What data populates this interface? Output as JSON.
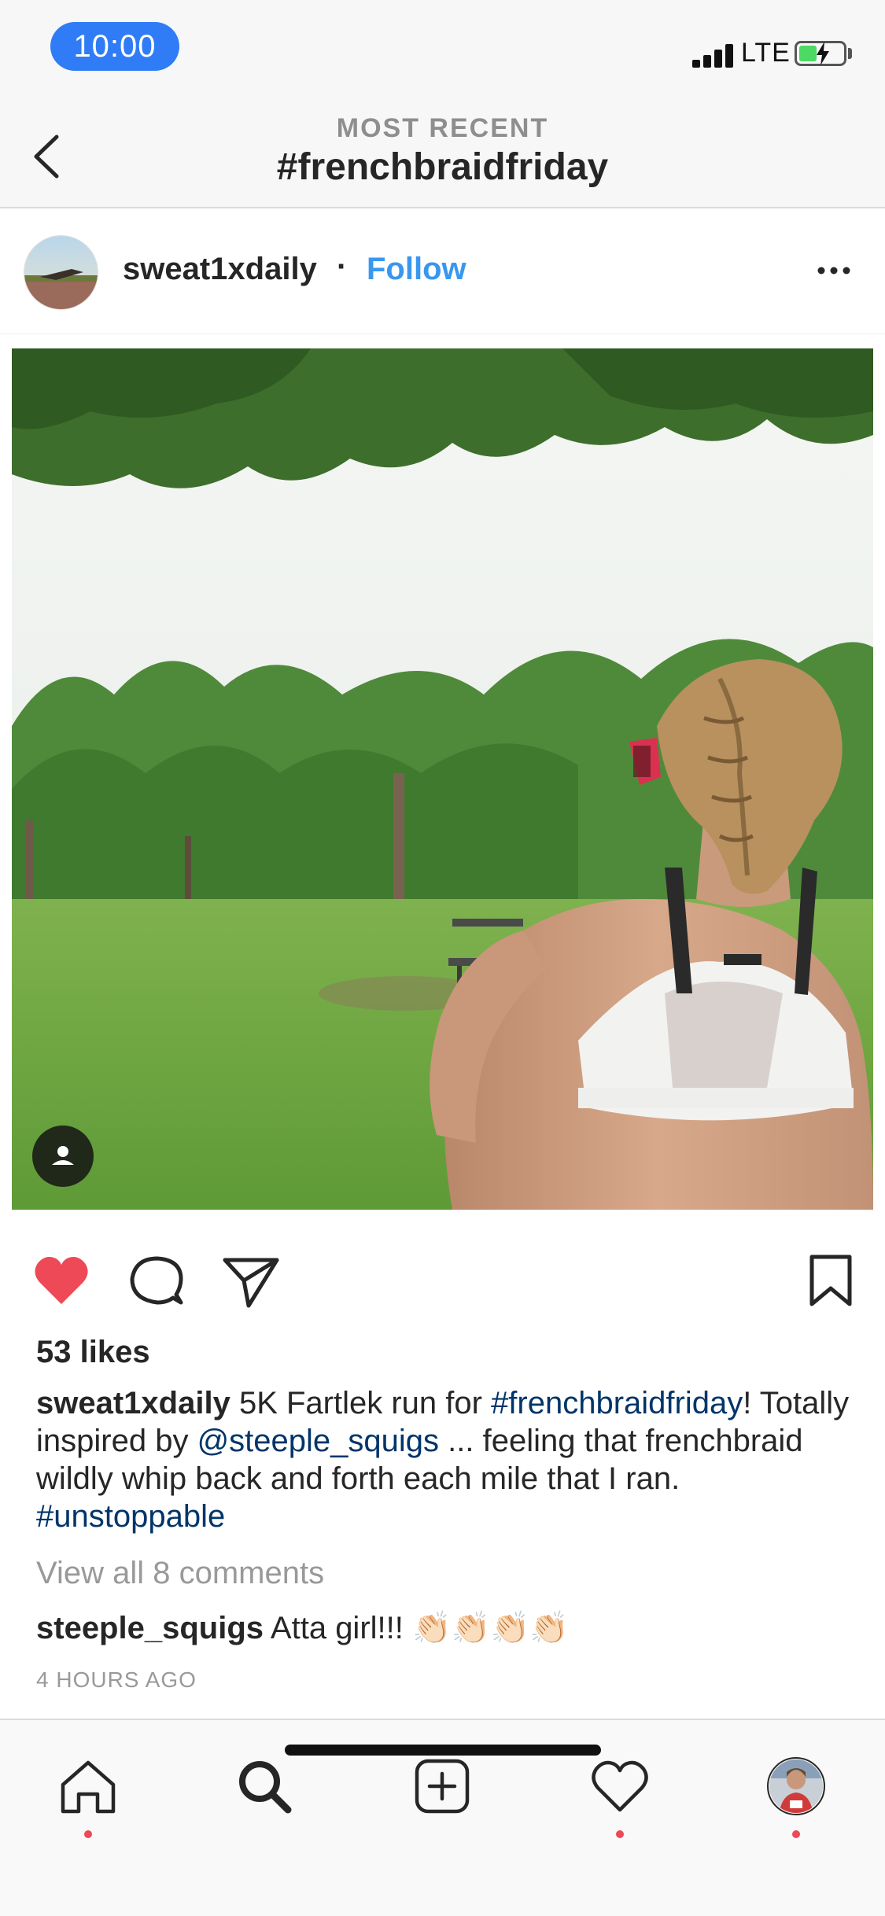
{
  "status_bar": {
    "time": "10:00",
    "network": "LTE"
  },
  "header": {
    "subtitle": "MOST RECENT",
    "title": "#frenchbraidfriday"
  },
  "post": {
    "username": "sweat1xdaily",
    "separator": "·",
    "follow_label": "Follow",
    "likes": "53 likes",
    "caption": {
      "username": "sweat1xdaily",
      "text_1": " 5K Fartlek run for ",
      "hashtag_1": "#frenchbraidfriday",
      "text_2": "! Totally inspired by ",
      "mention": "@steeple_squigs",
      "text_3": " ... feeling that frenchbraid wildly whip back and forth each mile that I ran. ",
      "hashtag_2": "#unstoppable"
    },
    "view_all_comments": "View all 8 comments",
    "comment": {
      "username": "steeple_squigs",
      "text": " Atta girl!!! 👏🏻👏🏻👏🏻👏🏻"
    },
    "timestamp": "4 HOURS AGO"
  },
  "icons": {
    "back": "chevron-left-icon",
    "more": "more-horizontal-icon",
    "like": "heart-filled-icon",
    "comment": "comment-icon",
    "share": "send-icon",
    "save": "bookmark-icon",
    "tagged": "user-tag-icon"
  },
  "tabbar": {
    "items": [
      "home",
      "search",
      "add",
      "activity",
      "profile"
    ]
  },
  "colors": {
    "accent": "#3897f0",
    "like": "#ed4956",
    "hashtag": "#003569",
    "time_pill": "#2f7cf6"
  }
}
